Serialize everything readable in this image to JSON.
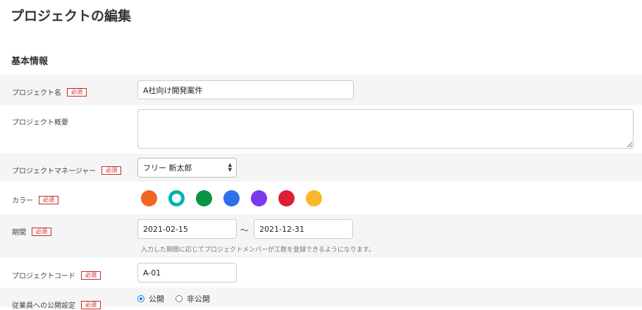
{
  "page": {
    "title": "プロジェクトの編集"
  },
  "section": {
    "title": "基本情報"
  },
  "required_label": "必須",
  "fields": {
    "project_name": {
      "label": "プロジェクト名",
      "value": "A社向け開発案件"
    },
    "project_summary": {
      "label": "プロジェクト概要",
      "value": ""
    },
    "project_manager": {
      "label": "プロジェクトマネージャー",
      "value": "フリー 新太郎"
    },
    "color": {
      "label": "カラー",
      "options": [
        "#f26522",
        "#00b3b3",
        "#0b9444",
        "#2f6fec",
        "#7c3aed",
        "#dc1f36",
        "#fbb726"
      ],
      "selected_index": 1
    },
    "period": {
      "label": "期間",
      "start": "2021-02-15",
      "separator": "～",
      "end": "2021-12-31",
      "help": "入力した期間に応じてプロジェクトメンバーが工数を登録できるようになります。"
    },
    "project_code": {
      "label": "プロジェクトコード",
      "value": "A-01"
    },
    "visibility": {
      "label": "従業員への公開設定",
      "options": [
        {
          "label": "公開",
          "checked": true
        },
        {
          "label": "非公開",
          "checked": false
        }
      ]
    }
  }
}
